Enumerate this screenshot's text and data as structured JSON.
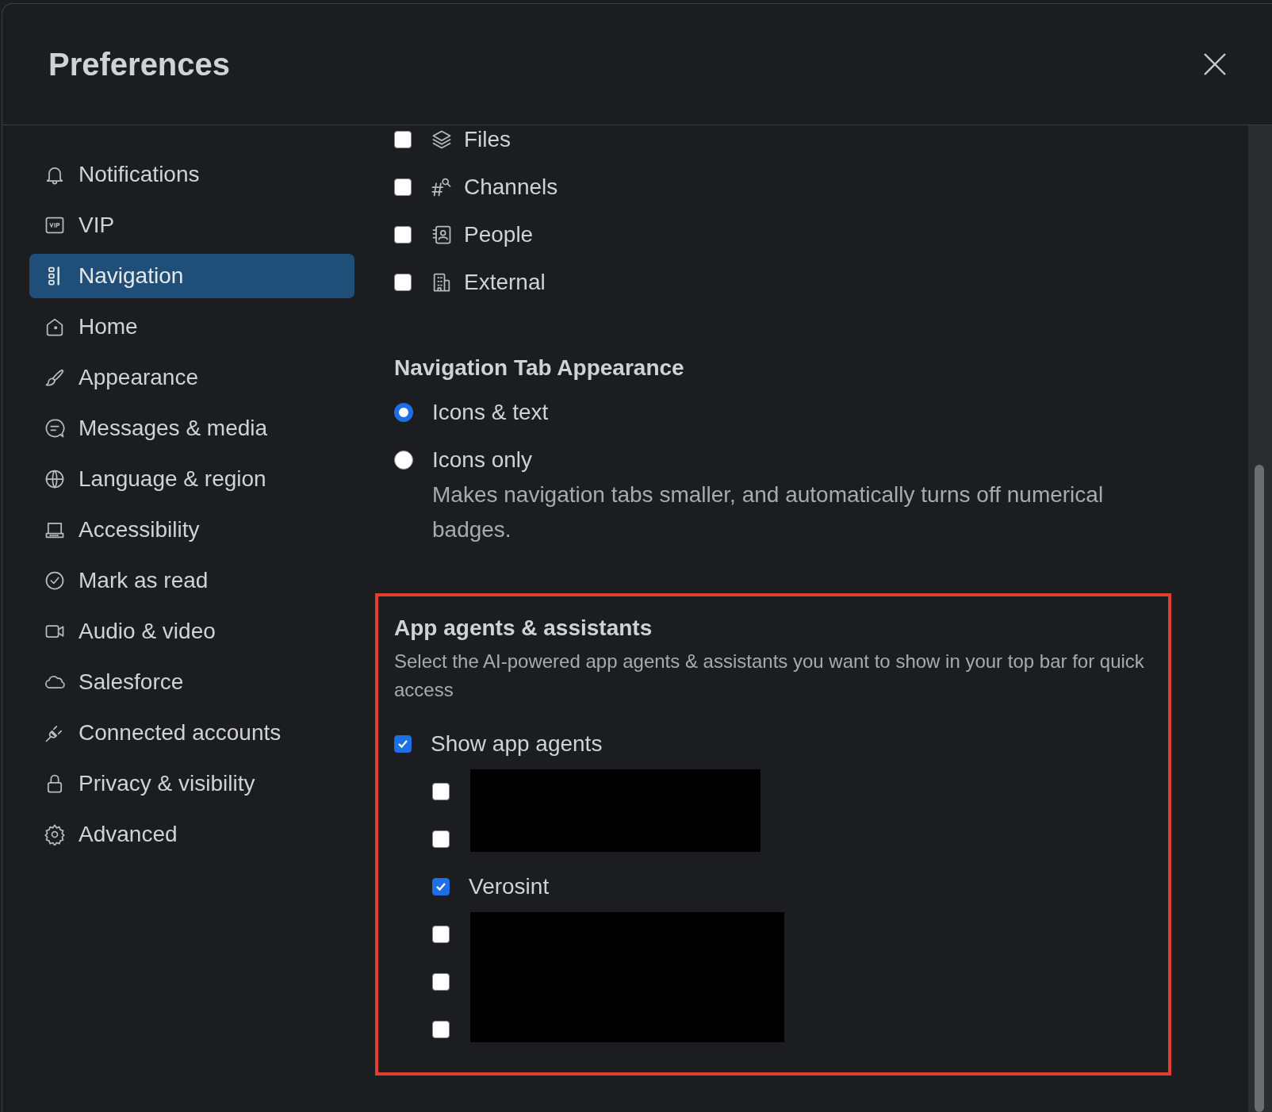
{
  "dialog": {
    "title": "Preferences"
  },
  "sidebar": {
    "items": [
      {
        "label": "Notifications",
        "selected": false
      },
      {
        "label": "VIP",
        "selected": false
      },
      {
        "label": "Navigation",
        "selected": true
      },
      {
        "label": "Home",
        "selected": false
      },
      {
        "label": "Appearance",
        "selected": false
      },
      {
        "label": "Messages & media",
        "selected": false
      },
      {
        "label": "Language & region",
        "selected": false
      },
      {
        "label": "Accessibility",
        "selected": false
      },
      {
        "label": "Mark as read",
        "selected": false
      },
      {
        "label": "Audio & video",
        "selected": false
      },
      {
        "label": "Salesforce",
        "selected": false
      },
      {
        "label": "Connected accounts",
        "selected": false
      },
      {
        "label": "Privacy & visibility",
        "selected": false
      },
      {
        "label": "Advanced",
        "selected": false
      }
    ]
  },
  "nav_tabs": [
    {
      "label": "Files",
      "checked": false
    },
    {
      "label": "Channels",
      "checked": false
    },
    {
      "label": "People",
      "checked": false
    },
    {
      "label": "External",
      "checked": false
    }
  ],
  "tab_appearance": {
    "title": "Navigation Tab Appearance",
    "options": [
      {
        "label": "Icons & text",
        "selected": true
      },
      {
        "label": "Icons only",
        "selected": false,
        "description": "Makes navigation tabs smaller, and automatically turns off numerical badges."
      }
    ]
  },
  "app_agents": {
    "title": "App agents & assistants",
    "description": "Select the AI-powered app agents & assistants you want to show in your top bar for quick access",
    "show_app_agents": {
      "label": "Show app agents",
      "checked": true
    },
    "agents": [
      {
        "kind": "redacted",
        "items": [
          {
            "checked": false
          },
          {
            "checked": false
          }
        ]
      },
      {
        "kind": "agent",
        "label": "Verosint",
        "checked": true
      },
      {
        "kind": "redacted",
        "items": [
          {
            "checked": false
          },
          {
            "checked": false
          },
          {
            "checked": false
          }
        ]
      }
    ]
  }
}
